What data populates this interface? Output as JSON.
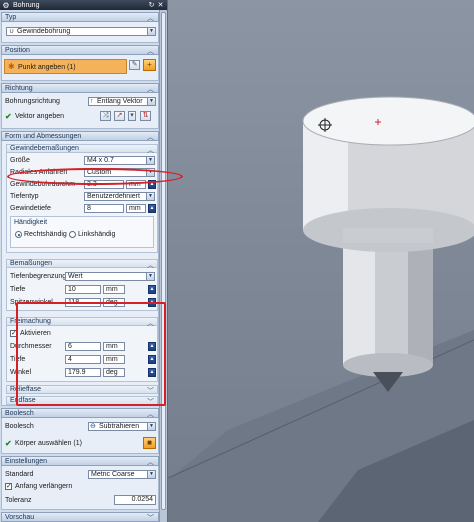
{
  "titlebar": {
    "title": "Bohrung"
  },
  "typ": {
    "header": "Typ",
    "value": "Gewindebohrung"
  },
  "position": {
    "header": "Position",
    "punkt_label": "Punkt angeben (1)"
  },
  "richtung": {
    "header": "Richtung",
    "bohrungsrichtung_label": "Bohrungsrichtung",
    "bohrungsrichtung_value": "Entlang Vektor",
    "vektor_label": "Vektor angeben"
  },
  "form": {
    "header": "Form und Abmessungen",
    "gewinde": {
      "header": "Gewindebemaßungen",
      "groesse_label": "Größe",
      "groesse_value": "M4 x 0.7",
      "radiales_label": "Radiales Anfahren",
      "radiales_value": "Custom",
      "durchmesser_label": "Gewindebohrdurchm",
      "durchmesser_value": "3.3",
      "durchmesser_unit": "mm",
      "tiefentyp_label": "Tiefentyp",
      "tiefentyp_value": "Benutzerdefiniert",
      "gewindetiefe_label": "Gewindetiefe",
      "gewindetiefe_value": "8",
      "gewindetiefe_unit": "mm",
      "haendigkeit_label": "Händigkeit",
      "rechts_label": "Rechtshändig",
      "links_label": "Linkshändig"
    },
    "bemassungen": {
      "header": "Bemaßungen",
      "tiefenbegrenzung_label": "Tiefenbegrenzung",
      "tiefenbegrenzung_value": "Wert",
      "tiefe_label": "Tiefe",
      "tiefe_value": "10",
      "tiefe_unit": "mm",
      "spitzenwinkel_label": "Spitzenwinkel",
      "spitzenwinkel_value": "118",
      "spitzenwinkel_unit": "deg"
    },
    "freimachung": {
      "header": "Freimachung",
      "aktivieren_label": "Aktivieren",
      "durchmesser_label": "Durchmesser",
      "durchmesser_value": "6",
      "durchmesser_unit": "mm",
      "tiefe_label": "Tiefe",
      "tiefe_value": "4",
      "tiefe_unit": "mm",
      "winkel_label": "Winkel",
      "winkel_value": "179.9",
      "winkel_unit": "deg"
    },
    "relieffase_header": "Relieffase",
    "endfase_header": "Endfase"
  },
  "boolesch": {
    "header": "Boolesch",
    "label": "Boolesch",
    "value": "Subtrahieren",
    "koerper_label": "Körper auswählen (1)"
  },
  "einstellungen": {
    "header": "Einstellungen",
    "standard_label": "Standard",
    "standard_value": "Metric Coarse",
    "anfang_label": "Anfang verlängern",
    "toleranz_label": "Toleranz",
    "toleranz_value": "0.0254"
  },
  "vorschau": {
    "header": "Vorschau"
  },
  "colors": {
    "highlight_red": "#d61f26",
    "panel_bg": "#cfdcec",
    "accent_blue": "#1c3f7d"
  }
}
